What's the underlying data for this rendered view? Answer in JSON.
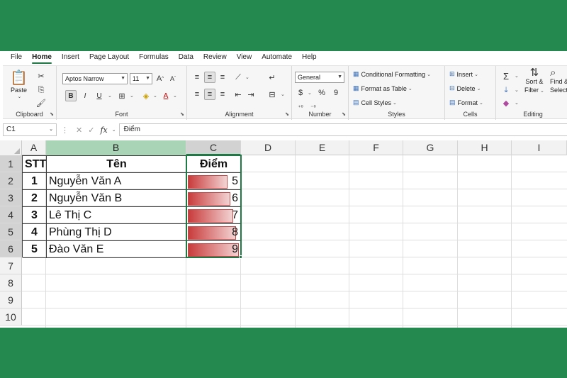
{
  "menu": {
    "tabs": [
      "File",
      "Home",
      "Insert",
      "Page Layout",
      "Formulas",
      "Data",
      "Review",
      "View",
      "Automate",
      "Help"
    ],
    "active": "Home"
  },
  "ribbon": {
    "clipboard": {
      "label": "Clipboard",
      "paste": "Paste"
    },
    "font": {
      "label": "Font",
      "name": "Aptos Narrow",
      "size": "11",
      "bold": "B",
      "italic": "I",
      "underline": "U",
      "grow": "A",
      "shrink": "A"
    },
    "alignment": {
      "label": "Alignment"
    },
    "number": {
      "label": "Number",
      "format": "General",
      "currency": "$",
      "percent": "%",
      "comma": "9"
    },
    "styles": {
      "label": "Styles",
      "conditional": "Conditional Formatting",
      "format_table": "Format as Table",
      "cell_styles": "Cell Styles"
    },
    "cells": {
      "label": "Cells",
      "insert": "Insert",
      "delete": "Delete",
      "format": "Format"
    },
    "editing": {
      "label": "Editing",
      "sort": "Sort &",
      "filter": "Filter",
      "find": "Find &",
      "select": "Select"
    }
  },
  "formula_bar": {
    "name_box": "C1",
    "fx": "fx",
    "value": "Điểm"
  },
  "grid": {
    "columns": [
      "A",
      "B",
      "C",
      "D",
      "E",
      "F",
      "G",
      "H",
      "I"
    ],
    "rows": [
      "1",
      "2",
      "3",
      "4",
      "5",
      "6",
      "7",
      "8",
      "9",
      "10"
    ],
    "header": {
      "stt": "STT",
      "name": "Tên",
      "score": "Điểm"
    },
    "data": [
      {
        "stt": "1",
        "name": "Nguyễn Văn A",
        "score": 5
      },
      {
        "stt": "2",
        "name": "Nguyễn Văn B",
        "score": 6
      },
      {
        "stt": "3",
        "name": "Lê Thị C",
        "score": 7
      },
      {
        "stt": "4",
        "name": "Phùng Thị D",
        "score": 8
      },
      {
        "stt": "5",
        "name": "Đào Văn E",
        "score": 9
      }
    ]
  },
  "colors": {
    "accent": "#1d7a44",
    "background": "#23894e",
    "databar": "#c93c3c"
  }
}
